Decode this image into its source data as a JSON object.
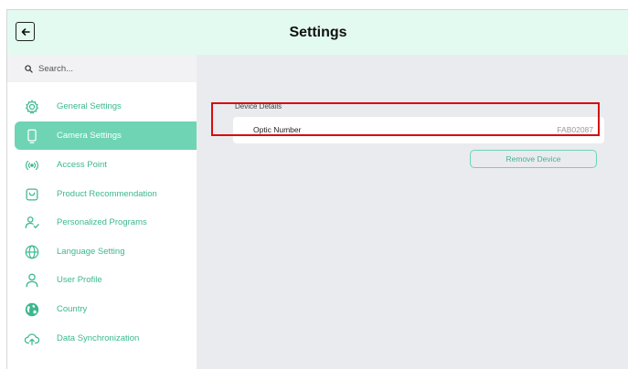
{
  "header": {
    "title": "Settings",
    "back_icon": "arrow-left-icon"
  },
  "search": {
    "placeholder": "Search...",
    "icon": "search-icon"
  },
  "sidebar": {
    "active_color": "#6ed4b4",
    "label_color": "#3ab88e",
    "items": [
      {
        "label": "General Settings",
        "icon": "gear-icon",
        "active": false
      },
      {
        "label": "Camera Settings",
        "icon": "camera-device-icon",
        "active": true
      },
      {
        "label": "Access Point",
        "icon": "wifi-signal-icon",
        "active": false
      },
      {
        "label": "Product Recommendation",
        "icon": "shopping-bag-icon",
        "active": false
      },
      {
        "label": "Personalized Programs",
        "icon": "user-check-icon",
        "active": false
      },
      {
        "label": "Language Setting",
        "icon": "globe-icon",
        "active": false
      },
      {
        "label": "User Profile",
        "icon": "user-icon",
        "active": false
      },
      {
        "label": "Country",
        "icon": "earth-icon",
        "active": false
      },
      {
        "label": "Data Synchronization",
        "icon": "cloud-upload-icon",
        "active": false
      }
    ]
  },
  "main": {
    "section_title": "Device Details",
    "optic": {
      "label": "Optic Number",
      "value": "FAB02087"
    },
    "remove_label": "Remove Device",
    "highlight_color": "#d60d0d"
  }
}
